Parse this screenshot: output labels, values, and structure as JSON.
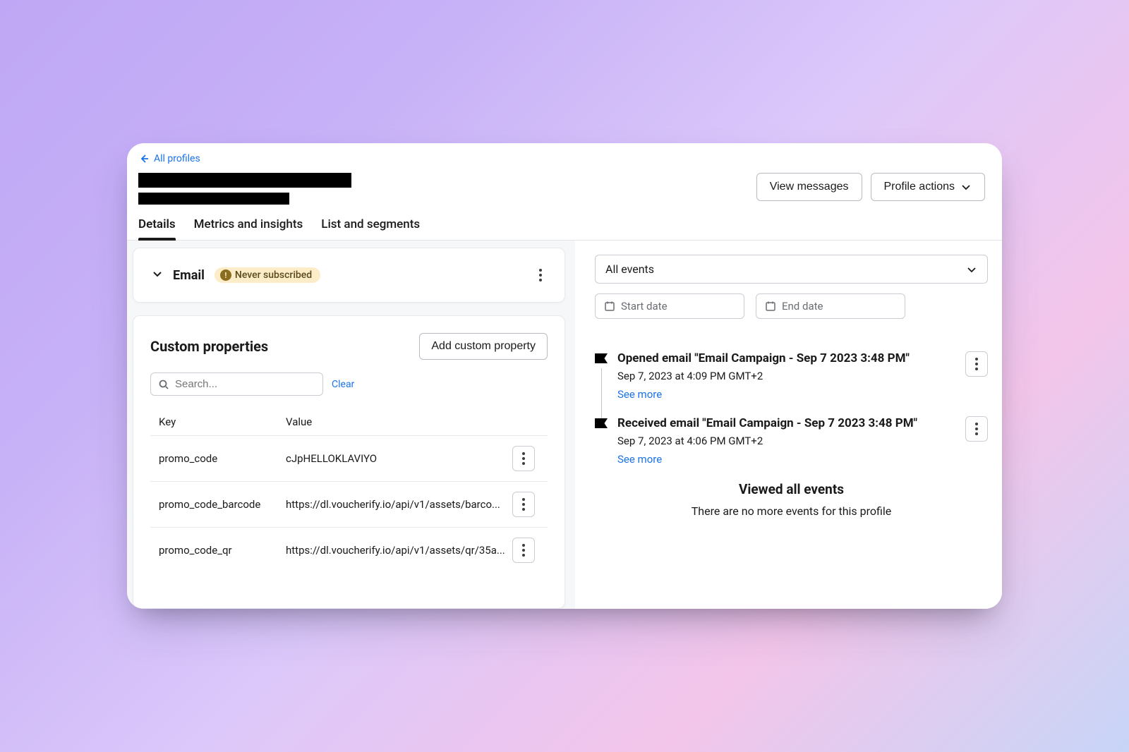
{
  "back_link": "All profiles",
  "header_actions": {
    "view_messages": "View messages",
    "profile_actions": "Profile actions"
  },
  "tabs": {
    "details": "Details",
    "metrics": "Metrics and insights",
    "lists": "List and segments"
  },
  "email_section": {
    "title": "Email",
    "badge": "Never subscribed"
  },
  "custom_properties": {
    "title": "Custom properties",
    "add_button": "Add custom property",
    "search_placeholder": "Search...",
    "clear": "Clear",
    "header_key": "Key",
    "header_value": "Value",
    "rows": [
      {
        "key": "promo_code",
        "value": "cJpHELLOKLAVIYO"
      },
      {
        "key": "promo_code_barcode",
        "value": "https://dl.voucherify.io/api/v1/assets/barco..."
      },
      {
        "key": "promo_code_qr",
        "value": "https://dl.voucherify.io/api/v1/assets/qr/35a..."
      }
    ]
  },
  "events_filter": {
    "select": "All events",
    "start": "Start date",
    "end": "End date"
  },
  "events": [
    {
      "title": "Opened email \"Email Campaign - Sep 7 2023 3:48 PM\"",
      "time": "Sep 7, 2023 at 4:09 PM GMT+2",
      "more": "See more"
    },
    {
      "title": "Received email \"Email Campaign - Sep 7 2023 3:48 PM\"",
      "time": "Sep 7, 2023 at 4:06 PM GMT+2",
      "more": "See more"
    }
  ],
  "viewed": {
    "title": "Viewed all events",
    "sub": "There are no more events for this profile"
  }
}
